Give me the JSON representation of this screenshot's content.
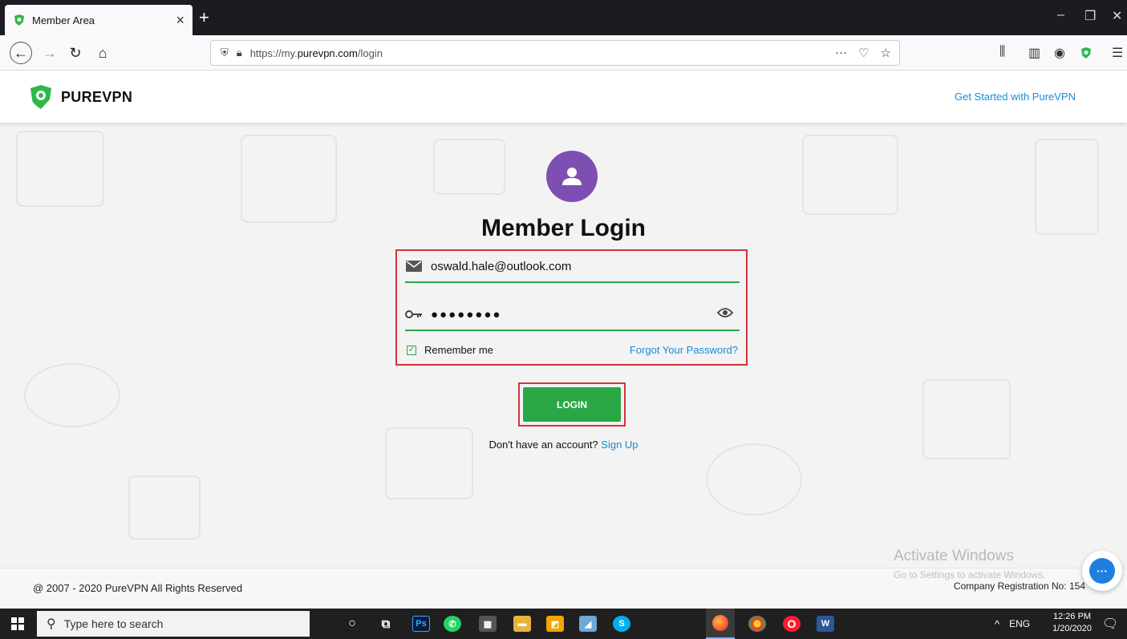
{
  "browser": {
    "tab_title": "Member Area",
    "url_prefix": "https://my.",
    "url_host": "purevpn.com",
    "url_path": "/login"
  },
  "site": {
    "logo_text": "PUREVPN",
    "get_started": "Get Started with PureVPN"
  },
  "login": {
    "title": "Member Login",
    "email_value": "oswald.hale@outlook.com",
    "password_masked": "●●●●●●●●",
    "remember_label": "Remember me",
    "forgot_label": "Forgot Your Password?",
    "login_button": "LOGIN",
    "no_account_text": "Don't have an account? ",
    "signup_label": "Sign Up"
  },
  "footer": {
    "copyright": "@ 2007 - 2020 PureVPN All Rights Reserved",
    "company_reg": "Company Registration No: 154"
  },
  "watermark": {
    "line1": "Activate Windows",
    "line2": "Go to Settings to activate Windows."
  },
  "taskbar": {
    "search_placeholder": "Type here to search",
    "language": "ENG",
    "time": "12:26 PM",
    "date": "1/20/2020"
  },
  "colors": {
    "accent_green": "#29a745",
    "highlight_red": "#d1343c",
    "avatar_purple": "#7e4fb3",
    "link_blue": "#1a8ad8"
  }
}
